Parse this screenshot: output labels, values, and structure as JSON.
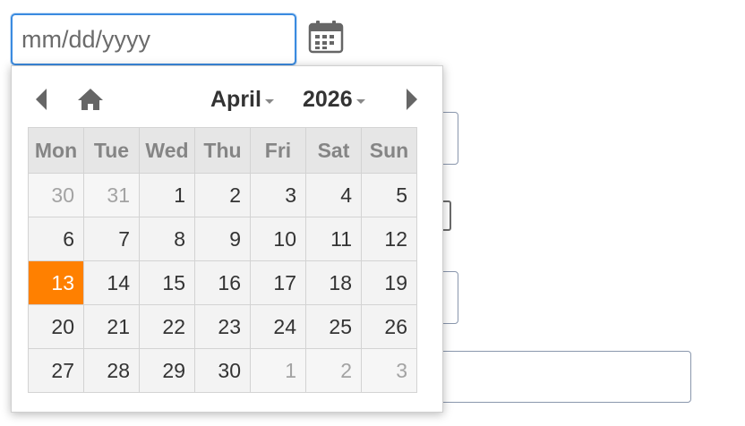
{
  "date_input": {
    "placeholder": "mm/dd/yyyy",
    "value": ""
  },
  "calendar": {
    "month_label": "April",
    "year_label": "2026",
    "weekdays": [
      "Mon",
      "Tue",
      "Wed",
      "Thu",
      "Fri",
      "Sat",
      "Sun"
    ],
    "weeks": [
      [
        {
          "d": "30",
          "other": true
        },
        {
          "d": "31",
          "other": true
        },
        {
          "d": "1"
        },
        {
          "d": "2"
        },
        {
          "d": "3"
        },
        {
          "d": "4"
        },
        {
          "d": "5"
        }
      ],
      [
        {
          "d": "6"
        },
        {
          "d": "7"
        },
        {
          "d": "8"
        },
        {
          "d": "9"
        },
        {
          "d": "10"
        },
        {
          "d": "11"
        },
        {
          "d": "12"
        }
      ],
      [
        {
          "d": "13",
          "selected": true
        },
        {
          "d": "14"
        },
        {
          "d": "15"
        },
        {
          "d": "16"
        },
        {
          "d": "17"
        },
        {
          "d": "18"
        },
        {
          "d": "19"
        }
      ],
      [
        {
          "d": "20"
        },
        {
          "d": "21"
        },
        {
          "d": "22"
        },
        {
          "d": "23"
        },
        {
          "d": "24"
        },
        {
          "d": "25"
        },
        {
          "d": "26"
        }
      ],
      [
        {
          "d": "27"
        },
        {
          "d": "28"
        },
        {
          "d": "29"
        },
        {
          "d": "30"
        },
        {
          "d": "1",
          "other": true
        },
        {
          "d": "2",
          "other": true
        },
        {
          "d": "3",
          "other": true
        }
      ]
    ]
  },
  "icons": {
    "prev": "chevron-left-icon",
    "home": "home-icon",
    "next": "chevron-right-icon",
    "calendar": "calendar-icon"
  },
  "colors": {
    "selected_day": "#ff8000",
    "input_focus_border": "#3b8be0",
    "header_bg": "#e6e6e6",
    "day_bg": "#f3f3f3"
  }
}
